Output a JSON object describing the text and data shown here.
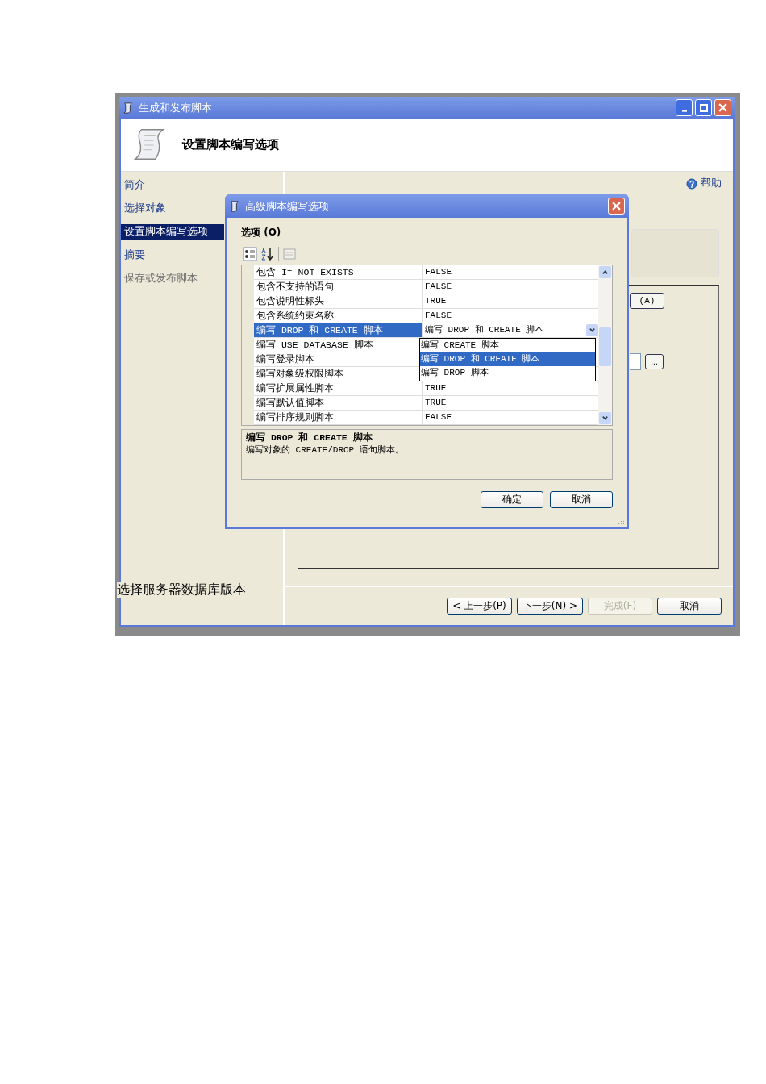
{
  "window": {
    "title": "生成和发布脚本"
  },
  "header": {
    "title": "设置脚本编写选项"
  },
  "nav": [
    {
      "label": "简介",
      "selected": false,
      "disabled": false
    },
    {
      "label": "选择对象",
      "selected": false,
      "disabled": false
    },
    {
      "label": "设置脚本编写选项",
      "selected": true,
      "disabled": false
    },
    {
      "label": "摘要",
      "selected": false,
      "disabled": false
    },
    {
      "label": "保存或发布脚本",
      "selected": false,
      "disabled": true
    }
  ],
  "help": "帮助",
  "background": {
    "button_partial": "(A)",
    "browse_button": "..."
  },
  "dialog": {
    "title": "高级脚本编写选项",
    "options_label": "选项 (O)",
    "rows": [
      {
        "name": "包含 If NOT EXISTS",
        "value": "FALSE",
        "selected": false
      },
      {
        "name": "包含不支持的语句",
        "value": "FALSE",
        "selected": false
      },
      {
        "name": "包含说明性标头",
        "value": "TRUE",
        "selected": false
      },
      {
        "name": "包含系统约束名称",
        "value": "FALSE",
        "selected": false
      },
      {
        "name": "编写 DROP 和 CREATE 脚本",
        "value": "编写 DROP 和 CREATE 脚本",
        "selected": true
      },
      {
        "name": "编写 USE DATABASE 脚本",
        "selected": false
      },
      {
        "name": "编写登录脚本",
        "selected": false
      },
      {
        "name": "编写对象级权限脚本",
        "selected": false
      },
      {
        "name": "编写扩展属性脚本",
        "value": "TRUE",
        "selected": false
      },
      {
        "name": "编写默认值脚本",
        "value": "TRUE",
        "selected": false
      },
      {
        "name": "编写排序规则脚本",
        "value": "FALSE",
        "selected": false
      }
    ],
    "dropdown": [
      {
        "label": "编写 CREATE 脚本",
        "selected": false
      },
      {
        "label": "编写 DROP 和 CREATE 脚本",
        "selected": true
      },
      {
        "label": "编写 DROP 脚本",
        "selected": false
      }
    ],
    "description": {
      "title": "编写 DROP 和 CREATE 脚本",
      "text": "编写对象的 CREATE/DROP 语句脚本。"
    },
    "buttons": [
      "确定",
      "取消"
    ]
  },
  "wizard_buttons": [
    {
      "label": "< 上一步(P)",
      "disabled": false
    },
    {
      "label": "下一步(N) >",
      "disabled": false
    },
    {
      "label": "完成(F)",
      "disabled": true
    },
    {
      "label": "取消",
      "disabled": false
    }
  ],
  "caption": "选择服务器数据库版本"
}
